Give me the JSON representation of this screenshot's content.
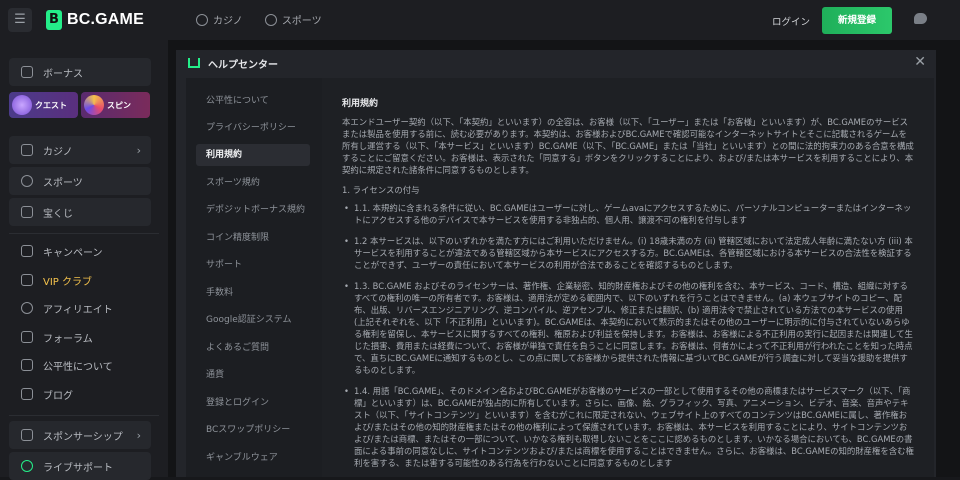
{
  "brand": {
    "logo_mark": "B",
    "name": "BC.GAME"
  },
  "topbar": {
    "nav": [
      {
        "label": "カジノ",
        "icon": "casino-icon"
      },
      {
        "label": "スポーツ",
        "icon": "sports-icon"
      }
    ],
    "login_label": "ログイン",
    "signup_label": "新規登録"
  },
  "sidebar": {
    "bonus_label": "ボーナス",
    "quest_label": "クエスト",
    "spin_label": "スピン",
    "group1": [
      {
        "label": "カジノ",
        "icon": "casino-icon",
        "chevron": "›"
      },
      {
        "label": "スポーツ",
        "icon": "sports-icon"
      },
      {
        "label": "宝くじ",
        "icon": "lottery-icon"
      }
    ],
    "group2": [
      {
        "label": "キャンペーン",
        "icon": "campaign-icon"
      },
      {
        "label": "VIP クラブ",
        "icon": "vip-icon"
      },
      {
        "label": "アフィリエイト",
        "icon": "affiliate-icon"
      },
      {
        "label": "フォーラム",
        "icon": "forum-icon"
      },
      {
        "label": "公平性について",
        "icon": "fairness-icon"
      },
      {
        "label": "ブログ",
        "icon": "blog-icon"
      }
    ],
    "group3": [
      {
        "label": "スポンサーシップ",
        "icon": "sponsorship-icon",
        "chevron": "›"
      },
      {
        "label": "ライブサポート",
        "icon": "headset-icon"
      }
    ]
  },
  "modal": {
    "title": "ヘルプセンター",
    "close": "✕",
    "menu": [
      "公平性について",
      "プライバシーポリシー",
      "利用規約",
      "スポーツ規約",
      "デポジットボーナス規約",
      "コイン精度制限",
      "サポート",
      "手数料",
      "Google認証システム",
      "よくあるご質問",
      "通貨",
      "登録とログイン",
      "BCスワップポリシー",
      "ギャンブルウェア"
    ],
    "active_index": 2,
    "content": {
      "heading": "利用規約",
      "intro": "本エンドユーザー契約（以下、「本契約」といいます）の全容は、お客様（以下、「ユーザー」または「お客様」といいます）が、BC.GAMEのサービスまたは製品を使用する前に、読む必要があります。本契約は、お客様およびBC.GAMEで確認可能なインターネットサイトとそこに記載されるゲームを所有し運営する（以下、「本サービス」といいます）BC.GAME（以下、「BC.GAME」または「当社」といいます）との間に法的拘束力のある合意を構成することにご留意ください。お客様は、表示された「同意する」ボタンをクリックすることにより、および/または本サービスを利用することにより、本契約に規定された諸条件に同意するものとします。",
      "section1": "1. ライセンスの付与",
      "items": [
        "1.1. 本規約に含まれる条件に従い、BC.GAMEはユーザーに対し、ゲームavaにアクセスするために、パーソナルコンピューターまたはインターネットにアクセスする他のデバイスで本サービスを使用する非独占的、個人用、譲渡不可の権利を付与します",
        "1.2 本サービスは、以下のいずれかを満たす方にはご利用いただけません。(i) 18歳未満の方 (ii) 管轄区域において法定成人年齢に満たない方 (iii) 本サービスを利用することが違法である管轄区域から本サービスにアクセスする方。BC.GAMEは、各管轄区域における本サービスの合法性を検証することができず、ユーザーの責任において本サービスの利用が合法であることを確認するものとします。",
        "1.3. BC.GAME およびそのライセンサーは、著作権、企業秘密、知的財産権およびその他の権利を含む、本サービス、コード、構造、組織に対するすべての権利の唯一の所有者です。お客様は、適用法が定める範囲内で、以下のいずれを行うことはできません。(a) 本ウェブサイトのコピー、配布、出版、リバースエンジニアリング、逆コンパイル、逆アセンブル、修正または翻訳、(b) 適用法令で禁止されている方法での本サービスの使用(上記それぞれを、以下「不正利用」といいます)。BC.GAMEは、本契約において黙示的またはその他のユーザーに明示的に付与されていないあらゆる権利を留保し、本サービスに関するすべての権利、権原および利益を保持します。お客様は、お客様による不正利用の実行に起因または関連して生じた損害、費用または経費について、お客様が単独で責任を負うことに同意します。お客様は、何者かによって不正利用が行われたことを知った時点で、直ちにBC.GAMEに通知するものとし、この点に関してお客様から提供された情報に基づいてBC.GAMEが行う調査に対して妥当な援助を提供するものとします。",
        "1.4. 用語「BC.GAME」、そのドメイン名およびBC.GAMEがお客様のサービスの一部として使用するその他の商標またはサービスマーク（以下、「商標」といいます）は、BC.GAMEが独占的に所有しています。さらに、画像、絵、グラフィック、写真、アニメーション、ビデオ、音楽、音声やテキスト（以下、「サイトコンテンツ」といいます）を含むがこれに限定されない、ウェブサイト上のすべてのコンテンツはBC.GAMEに属し、著作権および/またはその他の知的財産権またはその他の権利によって保護されています。お客様は、本サービスを利用することにより、サイトコンテンツおよび/または商標、またはその一部について、いかなる権利も取得しないことをここに認めるものとします。いかなる場合においても、BC.GAMEの書面による事前の同意なしに、サイトコンテンツおよび/または商標を使用することはできません。さらに、お客様は、BC.GAMEの知的財産権を含む権利を害する、または害する可能性のある行為を行わないことに同意するものとします"
      ]
    }
  },
  "colors": {
    "accent": "#24ee89",
    "signup": "#1fb85e",
    "vip": "#f4c24c"
  }
}
